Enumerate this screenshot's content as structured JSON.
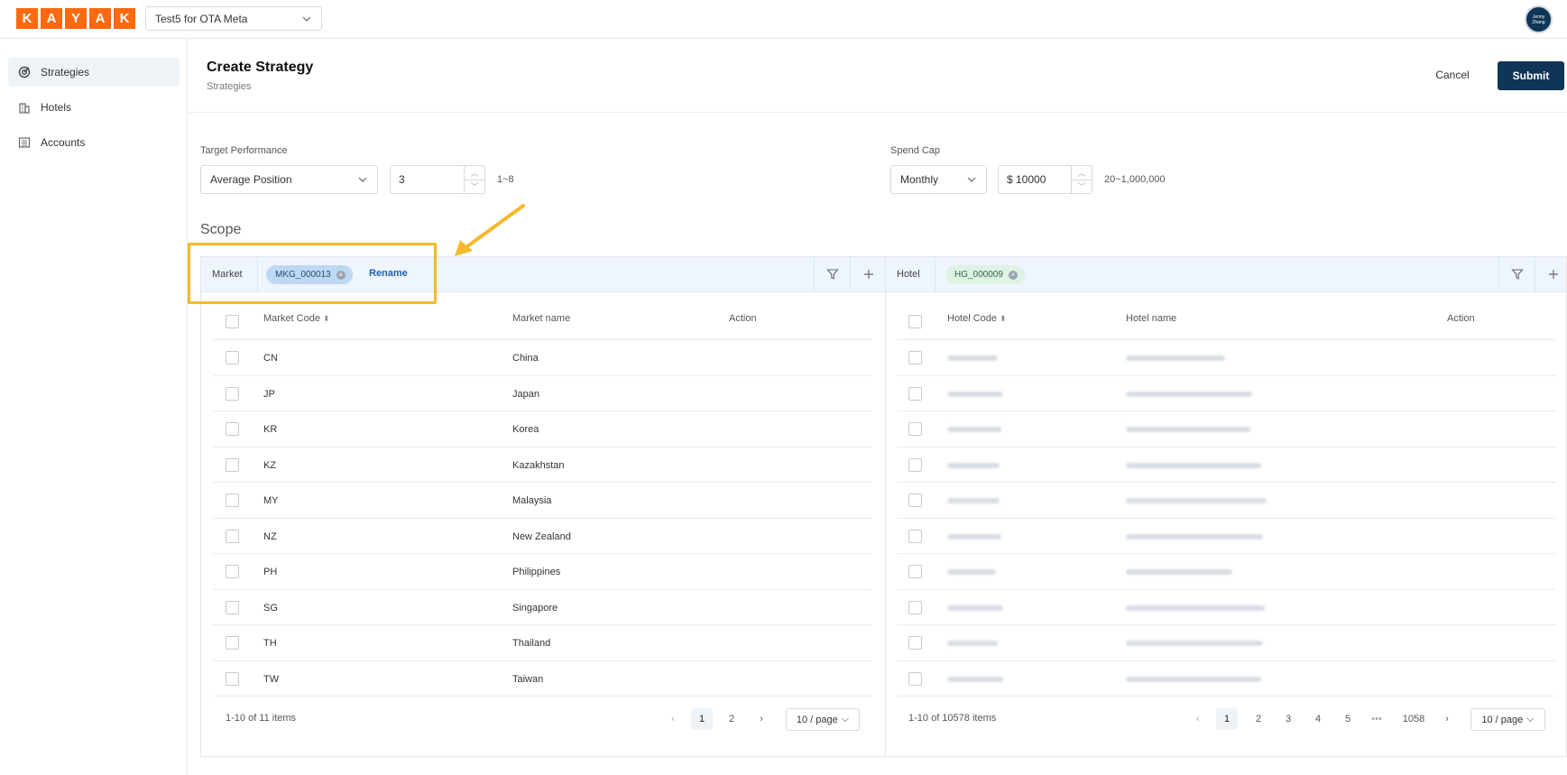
{
  "brand": {
    "letters": [
      "K",
      "A",
      "Y",
      "A",
      "K"
    ],
    "color": "#ff690f"
  },
  "account": {
    "selected": "Test5 for OTA Meta"
  },
  "user": {
    "initials": "Jenny Zhang"
  },
  "sidebar": {
    "items": [
      {
        "label": "Strategies",
        "icon": "target-icon",
        "active": true
      },
      {
        "label": "Hotels",
        "icon": "building-icon",
        "active": false
      },
      {
        "label": "Accounts",
        "icon": "list-icon",
        "active": false
      }
    ]
  },
  "header": {
    "title": "Create Strategy",
    "breadcrumb": "Strategies",
    "cancel_label": "Cancel",
    "submit_label": "Submit"
  },
  "target": {
    "label": "Target Performance",
    "metric": "Average Position",
    "value": "3",
    "range": "1~8"
  },
  "spend": {
    "label": "Spend Cap",
    "period": "Monthly",
    "value": "$ 10000",
    "range": "20~1,000,000"
  },
  "scope": {
    "title": "Scope"
  },
  "market": {
    "label": "Market",
    "chip": "MKG_000013",
    "rename_label": "Rename",
    "columns": {
      "code": "Market Code",
      "name": "Market name",
      "action": "Action"
    },
    "rows": [
      {
        "code": "CN",
        "name": "China"
      },
      {
        "code": "JP",
        "name": "Japan"
      },
      {
        "code": "KR",
        "name": "Korea"
      },
      {
        "code": "KZ",
        "name": "Kazakhstan"
      },
      {
        "code": "MY",
        "name": "Malaysia"
      },
      {
        "code": "NZ",
        "name": "New Zealand"
      },
      {
        "code": "PH",
        "name": "Philippines"
      },
      {
        "code": "SG",
        "name": "Singapore"
      },
      {
        "code": "TH",
        "name": "Thailand"
      },
      {
        "code": "TW",
        "name": "Taiwan"
      }
    ],
    "total": "1-10 of 11 items",
    "pages": [
      "1",
      "2"
    ],
    "page_size": "10 / page"
  },
  "hotel": {
    "label": "Hotel",
    "chip": "HG_000009",
    "columns": {
      "code": "Hotel Code",
      "name": "Hotel name",
      "action": "Action"
    },
    "row_count": 10,
    "total": "1-10 of 10578 items",
    "pages": [
      "1",
      "2",
      "3",
      "4",
      "5",
      "•••",
      "1058"
    ],
    "page_size": "10 / page"
  },
  "colors": {
    "primary": "#0f3557",
    "link": "#1d5fb3",
    "chip_market": "#bcd8f3",
    "chip_hotel": "#dff3e4",
    "annotation": "#f7b82a"
  }
}
